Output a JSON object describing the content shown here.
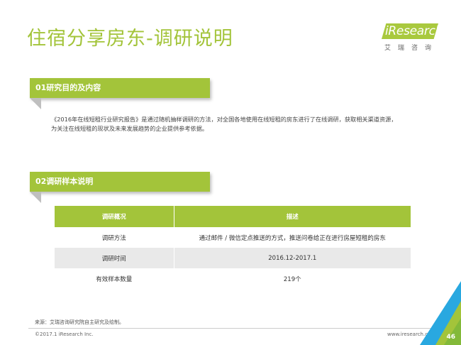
{
  "page": {
    "title": "住宿分享房东-调研说明",
    "number": "46"
  },
  "logo": {
    "word": "iResearch",
    "sub": "艾瑞咨询"
  },
  "section1": {
    "header": "01研究目的及内容",
    "lines": [
      "《2016年在线短租行业研究报告》是通过随机抽样调研的方法，对全国各地使用在线短租的房东进行了在线调研，获取相关渠道资源，",
      "为关注在线短租的现状及未来发展趋势的企业提供参考依据。"
    ]
  },
  "section2": {
    "header": "02调研样本说明",
    "table": {
      "headers": [
        "调研概况",
        "描述"
      ],
      "rows": [
        [
          "调研方法",
          "通过邮件 / 微信定点推送的方式，推送问卷给正在进行房屋短租的房东"
        ],
        [
          "调研时间",
          "2016.12-2017.1"
        ],
        [
          "有效样本数量",
          "219个"
        ]
      ]
    }
  },
  "footer": {
    "source": "来源：艾瑞咨询研究院自主研究及绘制。",
    "copyright": "©2017.1 iResearch Inc.",
    "website": "www.iresearch.com.cn"
  },
  "colors": {
    "accent": "#a3c43a",
    "row_alt": "#e9e9e9",
    "corner_blue": "#29a8e0"
  }
}
